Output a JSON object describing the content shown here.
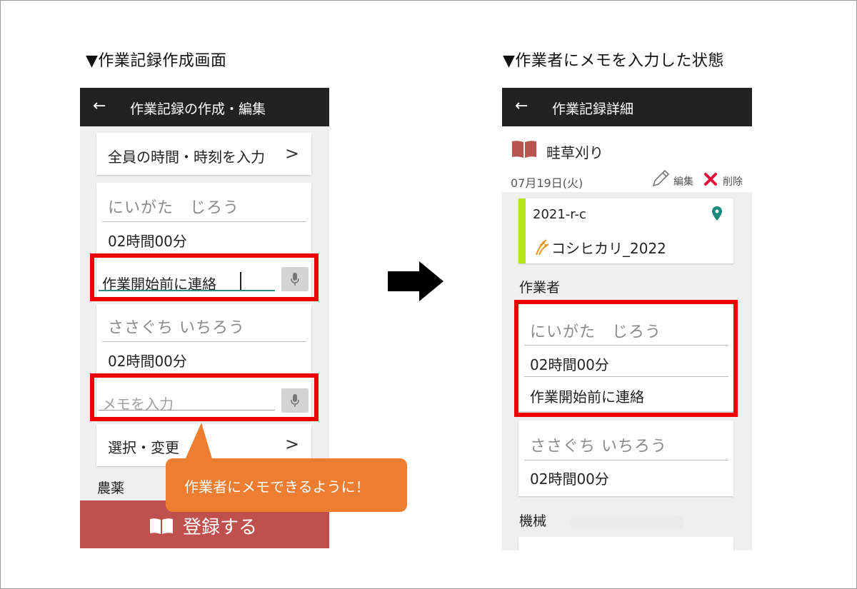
{
  "left_section": {
    "title": "▼作業記録作成画面"
  },
  "right_section": {
    "title": "▼作業者にメモを入力した状態"
  },
  "left_screen": {
    "back_icon": "←",
    "title": "作業記録の作成・編集",
    "bulk_time_row": {
      "label": "全員の時間・時刻を入力",
      "chevron": ">"
    },
    "workers": [
      {
        "name": "にいがた　じろう",
        "duration": "02時間00分",
        "memo_value": "作業開始前に連絡",
        "memo_placeholder": ""
      },
      {
        "name": "ささぐち いちろう",
        "duration": "02時間00分",
        "memo_value": "",
        "memo_placeholder": "メモを入力"
      }
    ],
    "select_change": {
      "label": "選択・変更",
      "chevron": ">"
    },
    "pesticide_label": "農薬",
    "register_button": {
      "label": "登録する"
    },
    "accent_color": "#c0504d"
  },
  "callout": {
    "text": "作業者にメモできるように！",
    "color": "#ed7d31"
  },
  "right_screen": {
    "back_icon": "←",
    "title": "作業記録詳細",
    "task_name": "畦草刈り",
    "date": "07月19日(火)",
    "edit_label": "編集",
    "delete_label": "削除",
    "field": {
      "name": "2021-r-c",
      "crop": "コシヒカリ_2022"
    },
    "workers_heading": "作業者",
    "workers": [
      {
        "name": "にいがた　じろう",
        "duration": "02時間00分",
        "memo": "作業開始前に連絡"
      },
      {
        "name": "ささぐち いちろう",
        "duration": "02時間00分"
      }
    ],
    "machines_heading": "機械"
  },
  "colors": {
    "highlight": "#ee0000",
    "appbar": "#222222",
    "field_bar": "#b5e61d",
    "pin": "#1a8a7a",
    "delete": "#e0123c"
  }
}
